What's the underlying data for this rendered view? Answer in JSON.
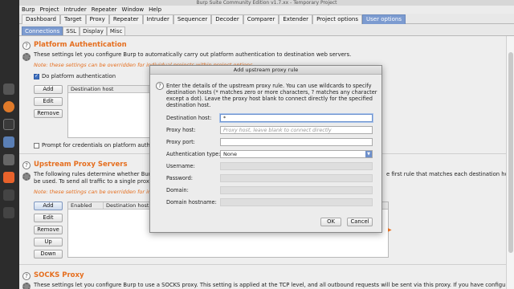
{
  "window": {
    "title": "Burp Suite Community Edition v1.7.xx - Temporary Project"
  },
  "menu": [
    "Burp",
    "Project",
    "Intruder",
    "Repeater",
    "Window",
    "Help"
  ],
  "tabs": [
    "Dashboard",
    "Target",
    "Proxy",
    "Repeater",
    "Intruder",
    "Sequencer",
    "Decoder",
    "Comparer",
    "Extender",
    "Project options",
    "User options"
  ],
  "subtabs": [
    "Connections",
    "SSL",
    "Display",
    "Misc"
  ],
  "platform_auth": {
    "title": "Platform Authentication",
    "desc": "These settings let you configure Burp to automatically carry out platform authentication to destination web servers.",
    "note": "Note: these settings can be overridden for individual projects within project options.",
    "checkbox_label": "Do platform authentication",
    "buttons": {
      "add": "Add",
      "edit": "Edit",
      "remove": "Remove"
    },
    "col_dest": "Destination host",
    "prompt_label": "Prompt for credentials on platform authen"
  },
  "upstream": {
    "title": "Upstream Proxy Servers",
    "desc1": "The following rules determine whether Burp s",
    "desc1_right": "e first rule that matches each destination host will",
    "desc2": "be used. To send all traffic to a single proxy s",
    "note": "Note: these settings can be overridden for ind",
    "buttons": {
      "add": "Add",
      "edit": "Edit",
      "remove": "Remove",
      "up": "Up",
      "down": "Down"
    },
    "cols": [
      "Enabled",
      "Destination host"
    ]
  },
  "socks": {
    "title": "SOCKS Proxy",
    "desc": "These settings let you configure Burp to use a SOCKS proxy. This setting is applied at the TCP level, and all outbound requests will be sent via this proxy. If you have configured rules for"
  },
  "dialog": {
    "title": "Add upstream proxy rule",
    "text": "Enter the details of the upstream proxy rule. You can use wildcards to specify destination hosts (* matches zero or more characters, ? matches any character except a dot). Leave the proxy host blank to connect directly for the specified destination host.",
    "dest_label": "Destination host:",
    "dest_value": "*",
    "proxy_host_label": "Proxy host:",
    "proxy_host_placeholder": "Proxy host, leave blank to connect directly",
    "proxy_port_label": "Proxy port:",
    "auth_label": "Authentication type:",
    "auth_value": "None",
    "username_label": "Username:",
    "password_label": "Password:",
    "domain_label": "Domain:",
    "hostname_label": "Domain hostname:",
    "ok": "OK",
    "cancel": "Cancel"
  },
  "colors": {
    "accent_orange": "#e56e1e",
    "tab_active": "#7c9bd0"
  }
}
